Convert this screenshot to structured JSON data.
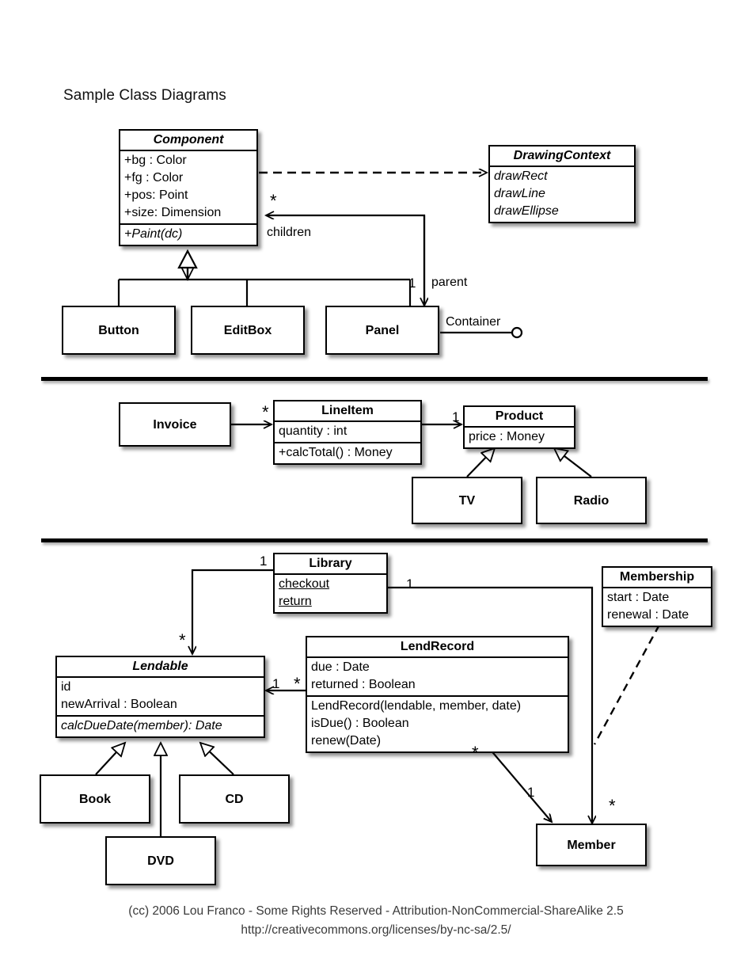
{
  "title": "Sample Class Diagrams",
  "sections": [
    {
      "id": "gui-components",
      "classes": [
        {
          "id": "component",
          "name": "Component",
          "abstract": true,
          "attributes": [
            "+bg : Color",
            "+fg : Color",
            "+pos: Point",
            "+size: Dimension"
          ],
          "operations": [
            "+Paint(dc)"
          ],
          "operations_italic": true
        },
        {
          "id": "drawingcontext",
          "name": "DrawingContext",
          "abstract": true,
          "attributes": [
            "drawRect",
            "drawLine",
            "drawEllipse"
          ],
          "attributes_italic": true,
          "operations": []
        },
        {
          "id": "button",
          "name": "Button",
          "attributes": [],
          "operations": []
        },
        {
          "id": "editbox",
          "name": "EditBox",
          "attributes": [],
          "operations": []
        },
        {
          "id": "panel",
          "name": "Panel",
          "attributes": [],
          "operations": []
        }
      ],
      "edge_labels": [
        {
          "id": "children",
          "text": "children"
        },
        {
          "id": "parent",
          "text": "parent"
        },
        {
          "id": "container",
          "text": "Container"
        }
      ],
      "multiplicities": [
        {
          "id": "component-children-star",
          "text": "*"
        },
        {
          "id": "panel-parent-one",
          "text": "1"
        }
      ]
    },
    {
      "id": "invoice-product",
      "classes": [
        {
          "id": "invoice",
          "name": "Invoice",
          "attributes": [],
          "operations": []
        },
        {
          "id": "lineitem",
          "name": "LineItem",
          "attributes": [
            "quantity : int"
          ],
          "operations": [
            "+calcTotal() : Money"
          ]
        },
        {
          "id": "product",
          "name": "Product",
          "attributes": [
            "price : Money"
          ],
          "operations": []
        },
        {
          "id": "tv",
          "name": "TV",
          "attributes": [],
          "operations": []
        },
        {
          "id": "radio",
          "name": "Radio",
          "attributes": [],
          "operations": []
        }
      ],
      "edge_labels": [],
      "multiplicities": [
        {
          "id": "lineitem-star",
          "text": "*"
        },
        {
          "id": "product-one",
          "text": "1"
        }
      ]
    },
    {
      "id": "library-lending",
      "classes": [
        {
          "id": "library",
          "name": "Library",
          "attributes": [
            "checkout",
            "return"
          ],
          "attributes_underline": true,
          "operations": []
        },
        {
          "id": "membership",
          "name": "Membership",
          "attributes": [
            "start : Date",
            "renewal : Date"
          ],
          "operations": []
        },
        {
          "id": "lendable",
          "name": "Lendable",
          "abstract": true,
          "attributes": [
            "id",
            "newArrival : Boolean"
          ],
          "operations": [
            "calcDueDate(member): Date"
          ],
          "operations_italic": true
        },
        {
          "id": "lendrecord",
          "name": "LendRecord",
          "attributes": [
            "due : Date",
            "returned : Boolean"
          ],
          "operations": [
            "LendRecord(lendable, member, date)",
            "isDue() : Boolean",
            "renew(Date)"
          ]
        },
        {
          "id": "book",
          "name": "Book",
          "attributes": [],
          "operations": []
        },
        {
          "id": "cd",
          "name": "CD",
          "attributes": [],
          "operations": []
        },
        {
          "id": "dvd",
          "name": "DVD",
          "attributes": [],
          "operations": []
        },
        {
          "id": "member",
          "name": "Member",
          "attributes": [],
          "operations": []
        }
      ],
      "edge_labels": [],
      "multiplicities": [
        {
          "id": "library-lendable-one",
          "text": "1"
        },
        {
          "id": "library-lendable-star",
          "text": "*"
        },
        {
          "id": "library-member-one",
          "text": "1"
        },
        {
          "id": "lendable-one",
          "text": "1"
        },
        {
          "id": "lendrecord-star",
          "text": "*"
        },
        {
          "id": "lendrecord-member-star",
          "text": "*"
        },
        {
          "id": "lendrecord-member-one",
          "text": "1"
        },
        {
          "id": "member-star",
          "text": "*"
        }
      ]
    }
  ],
  "footer": {
    "line1": "(cc) 2006 Lou Franco - Some Rights Reserved - Attribution-NonCommercial-ShareAlike 2.5",
    "line2": "http://creativecommons.org/licenses/by-nc-sa/2.5/"
  },
  "colors": {
    "ink": "#000000",
    "paper": "#ffffff",
    "footer_text": "#3a3a3a"
  }
}
